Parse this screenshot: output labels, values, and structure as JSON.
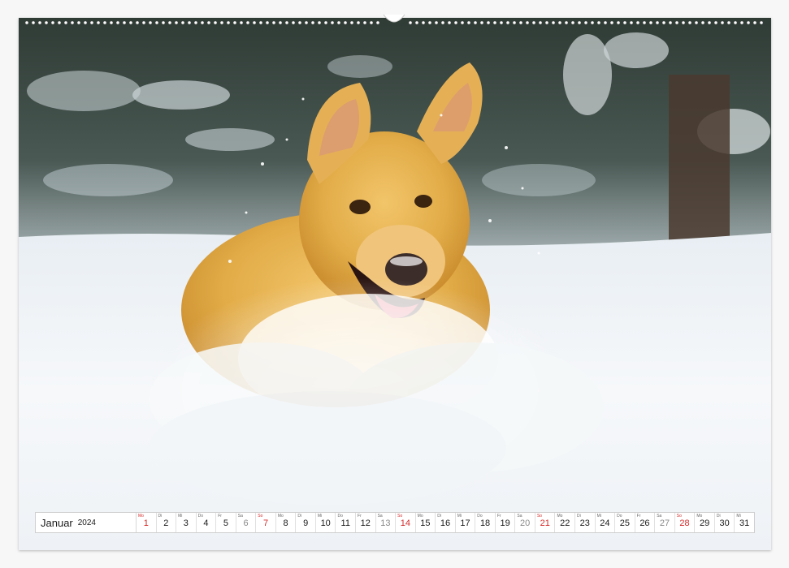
{
  "calendar": {
    "month": "Januar",
    "year": "2024",
    "days": [
      {
        "wd": "Mo",
        "d": "1",
        "type": "holiday"
      },
      {
        "wd": "Di",
        "d": "2",
        "type": "weekday"
      },
      {
        "wd": "Mi",
        "d": "3",
        "type": "weekday"
      },
      {
        "wd": "Do",
        "d": "4",
        "type": "weekday"
      },
      {
        "wd": "Fr",
        "d": "5",
        "type": "weekday"
      },
      {
        "wd": "Sa",
        "d": "6",
        "type": "sat"
      },
      {
        "wd": "So",
        "d": "7",
        "type": "sun"
      },
      {
        "wd": "Mo",
        "d": "8",
        "type": "weekday"
      },
      {
        "wd": "Di",
        "d": "9",
        "type": "weekday"
      },
      {
        "wd": "Mi",
        "d": "10",
        "type": "weekday"
      },
      {
        "wd": "Do",
        "d": "11",
        "type": "weekday"
      },
      {
        "wd": "Fr",
        "d": "12",
        "type": "weekday"
      },
      {
        "wd": "Sa",
        "d": "13",
        "type": "sat"
      },
      {
        "wd": "So",
        "d": "14",
        "type": "sun"
      },
      {
        "wd": "Mo",
        "d": "15",
        "type": "weekday"
      },
      {
        "wd": "Di",
        "d": "16",
        "type": "weekday"
      },
      {
        "wd": "Mi",
        "d": "17",
        "type": "weekday"
      },
      {
        "wd": "Do",
        "d": "18",
        "type": "weekday"
      },
      {
        "wd": "Fr",
        "d": "19",
        "type": "weekday"
      },
      {
        "wd": "Sa",
        "d": "20",
        "type": "sat"
      },
      {
        "wd": "So",
        "d": "21",
        "type": "sun"
      },
      {
        "wd": "Mo",
        "d": "22",
        "type": "weekday"
      },
      {
        "wd": "Di",
        "d": "23",
        "type": "weekday"
      },
      {
        "wd": "Mi",
        "d": "24",
        "type": "weekday"
      },
      {
        "wd": "Do",
        "d": "25",
        "type": "weekday"
      },
      {
        "wd": "Fr",
        "d": "26",
        "type": "weekday"
      },
      {
        "wd": "Sa",
        "d": "27",
        "type": "sat"
      },
      {
        "wd": "So",
        "d": "28",
        "type": "sun"
      },
      {
        "wd": "Mo",
        "d": "29",
        "type": "weekday"
      },
      {
        "wd": "Di",
        "d": "30",
        "type": "weekday"
      },
      {
        "wd": "Mi",
        "d": "31",
        "type": "weekday"
      }
    ]
  },
  "colors": {
    "sunday_red": "#d42a2a",
    "saturday_gray": "#8a8a8a",
    "snow": "#f4f7fa",
    "fur": "#e2ac48"
  },
  "photo": {
    "subject": "golden-retriever-dog-icon"
  }
}
